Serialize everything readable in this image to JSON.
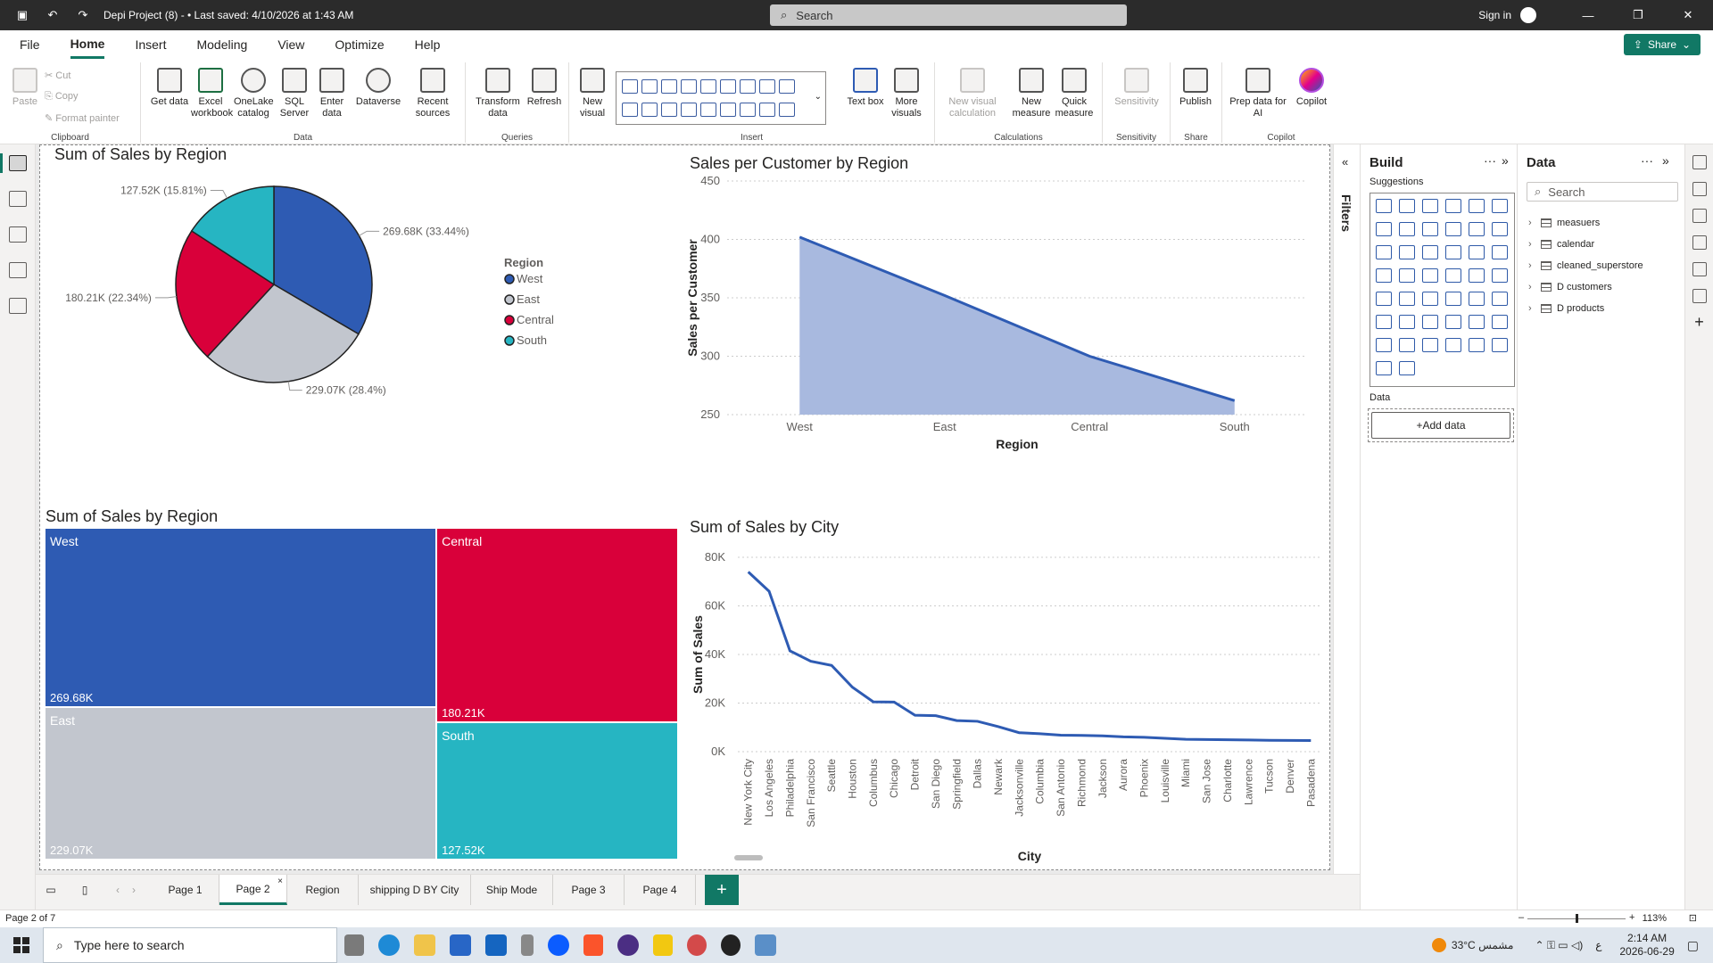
{
  "titlebar": {
    "title": "Depi Project (8) -  • Last saved: 4/10/2026 at 1:43 AM",
    "search_placeholder": "Search",
    "signin": "Sign in"
  },
  "menu": {
    "tabs": [
      "File",
      "Home",
      "Insert",
      "Modeling",
      "View",
      "Optimize",
      "Help"
    ],
    "active": "Home",
    "share": "Share"
  },
  "ribbon": {
    "clipboard": {
      "label": "Clipboard",
      "paste": "Paste",
      "cut": "Cut",
      "copy": "Copy",
      "format_painter": "Format painter"
    },
    "data": {
      "label": "Data",
      "get_data": "Get data",
      "excel": "Excel workbook",
      "onelake": "OneLake catalog",
      "sql": "SQL Server",
      "enter": "Enter data",
      "dataverse": "Dataverse",
      "recent": "Recent sources"
    },
    "queries": {
      "label": "Queries",
      "transform": "Transform data",
      "refresh": "Refresh"
    },
    "insert": {
      "label": "Insert",
      "new_visual": "New visual",
      "text_box": "Text box",
      "more_visuals": "More visuals"
    },
    "calculations": {
      "label": "Calculations",
      "new_visual_calc": "New visual calculation",
      "new_measure": "New measure",
      "quick_measure": "Quick measure"
    },
    "sensitivity": {
      "label": "Sensitivity",
      "btn": "Sensitivity"
    },
    "share": {
      "label": "Share",
      "publish": "Publish"
    },
    "copilot": {
      "label": "Copilot",
      "prep": "Prep data for AI",
      "copilot": "Copilot"
    }
  },
  "visuals": {
    "pie": {
      "title": "Sum of Sales by Region",
      "legend_title": "Region"
    },
    "area": {
      "title": "Sales per Customer by Region",
      "xlabel": "Region",
      "ylabel": "Sales per Customer"
    },
    "treemap": {
      "title": "Sum of Sales by Region"
    },
    "line": {
      "title": "Sum of Sales by City",
      "xlabel": "City",
      "ylabel": "Sum of Sales"
    }
  },
  "chart_data": [
    {
      "type": "pie",
      "title": "Sum of Sales by Region",
      "legend_title": "Region",
      "legend_position": "right",
      "categories": [
        "West",
        "East",
        "Central",
        "South"
      ],
      "values": [
        269.68,
        229.07,
        180.21,
        127.52
      ],
      "unit": "K",
      "labels": [
        "269.68K (33.44%)",
        "229.07K (28.4%)",
        "180.21K (22.34%)",
        "127.52K (15.81%)"
      ],
      "colors": [
        "#2e5bb3",
        "#c2c6ce",
        "#d9003a",
        "#26b5c2"
      ]
    },
    {
      "type": "area",
      "title": "Sales per Customer by Region",
      "xlabel": "Region",
      "ylabel": "Sales per Customer",
      "categories": [
        "West",
        "East",
        "Central",
        "South"
      ],
      "values": [
        402,
        352,
        300,
        262
      ],
      "ylim": [
        250,
        450
      ],
      "yticks": [
        250,
        300,
        350,
        400,
        450
      ],
      "grid": true,
      "colors": [
        "#2e5bb3",
        "#a8b9df"
      ]
    },
    {
      "type": "treemap",
      "title": "Sum of Sales by Region",
      "categories": [
        "West",
        "East",
        "Central",
        "South"
      ],
      "values": [
        269.68,
        229.07,
        180.21,
        127.52
      ],
      "labels": [
        "269.68K",
        "229.07K",
        "180.21K",
        "127.52K"
      ],
      "colors": [
        "#2e5bb3",
        "#c2c6ce",
        "#d9003a",
        "#26b5c2"
      ]
    },
    {
      "type": "line",
      "title": "Sum of Sales by City",
      "xlabel": "City",
      "ylabel": "Sum of Sales",
      "categories": [
        "New York City",
        "Los Angeles",
        "Philadelphia",
        "San Francisco",
        "Seattle",
        "Houston",
        "Columbus",
        "Chicago",
        "Detroit",
        "San Diego",
        "Springfield",
        "Dallas",
        "Newark",
        "Jacksonville",
        "Columbia",
        "San Antonio",
        "Richmond",
        "Jackson",
        "Aurora",
        "Phoenix",
        "Louisville",
        "Miami",
        "San Jose",
        "Charlotte",
        "Lawrence",
        "Tucson",
        "Denver",
        "Pasadena"
      ],
      "values": [
        74000,
        66000,
        41500,
        37200,
        35500,
        26500,
        20500,
        20400,
        15000,
        14800,
        12800,
        12500,
        10300,
        7800,
        7400,
        6800,
        6700,
        6500,
        6100,
        5900,
        5500,
        5100,
        5000,
        4900,
        4800,
        4700,
        4650,
        4600
      ],
      "ylim": [
        0,
        80000
      ],
      "yticks": [
        "0K",
        "20K",
        "40K",
        "60K",
        "80K"
      ],
      "grid": true,
      "colors": [
        "#2e5bb3"
      ]
    }
  ],
  "panes": {
    "filters": "Filters",
    "build": {
      "title": "Build",
      "suggestions": "Suggestions",
      "data_label": "Data",
      "add_data": "+Add data"
    },
    "data": {
      "title": "Data",
      "search_placeholder": "Search",
      "tables": [
        "measuers",
        "calendar",
        "cleaned_superstore",
        "D customers",
        "D products"
      ]
    }
  },
  "pages": {
    "tabs": [
      "Page 1",
      "Page 2",
      "Region",
      "shipping D BY City",
      "Ship Mode",
      "Page 3",
      "Page 4"
    ],
    "active": "Page 2",
    "status": "Page 2 of 7",
    "zoom": "113%"
  },
  "taskbar": {
    "search_placeholder": "Type here to search",
    "weather": "33°C  مشمس",
    "lang": "ع",
    "time": "2:14 AM",
    "date": "2026-06-29"
  }
}
